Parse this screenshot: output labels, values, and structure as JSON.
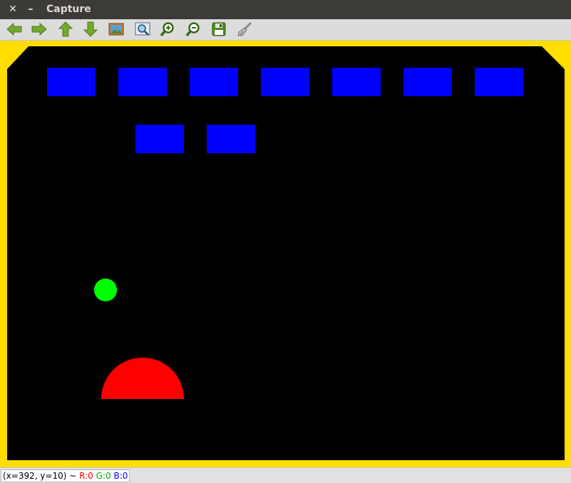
{
  "window": {
    "title": "Capture",
    "close_glyph": "✕",
    "minimize_glyph": "–"
  },
  "toolbar": {
    "buttons": [
      {
        "name": "arrow-left-icon"
      },
      {
        "name": "arrow-right-icon"
      },
      {
        "name": "arrow-up-icon"
      },
      {
        "name": "arrow-down-icon"
      },
      {
        "name": "image-icon"
      },
      {
        "name": "zoom-fit-icon"
      },
      {
        "name": "zoom-in-icon"
      },
      {
        "name": "zoom-out-icon"
      },
      {
        "name": "save-icon"
      },
      {
        "name": "brush-icon"
      }
    ]
  },
  "game": {
    "colors": {
      "border": "#ffdd00",
      "background": "#000000",
      "brick": "#0000ff",
      "ball": "#00ff00",
      "paddle": "#ff0000"
    },
    "bricks_row1_count": 7,
    "bricks_row2_count": 2
  },
  "status": {
    "coords": "(x=392, y=10) ~ ",
    "r": "R:0",
    "g": "G:0",
    "b": "B:0"
  }
}
